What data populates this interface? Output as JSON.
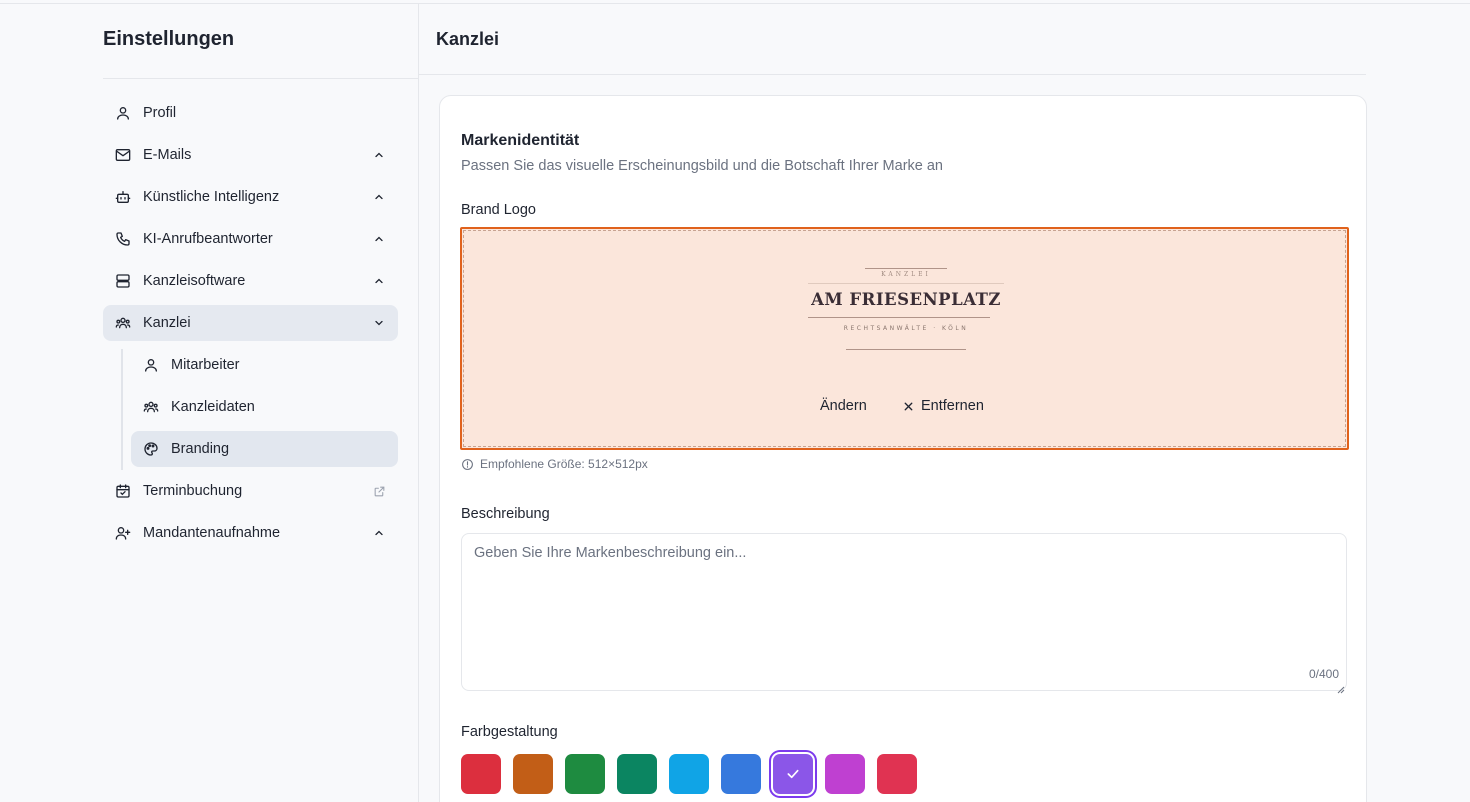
{
  "sidebar": {
    "title": "Einstellungen",
    "items": [
      {
        "label": "Profil",
        "icon": "user-icon"
      },
      {
        "label": "E-Mails",
        "icon": "mail-icon"
      },
      {
        "label": "Künstliche Intelligenz",
        "icon": "bot-icon"
      },
      {
        "label": "KI-Anrufbeantworter",
        "icon": "phone-icon"
      },
      {
        "label": "Kanzleisoftware",
        "icon": "server-icon"
      },
      {
        "label": "Kanzlei",
        "icon": "users-icon",
        "active": true
      },
      {
        "label": "Terminbuchung",
        "icon": "calendar-check-icon"
      },
      {
        "label": "Mandantenaufnahme",
        "icon": "user-plus-icon"
      }
    ],
    "sub_items": [
      {
        "label": "Mitarbeiter",
        "icon": "user-icon"
      },
      {
        "label": "Kanzleidaten",
        "icon": "users-icon"
      },
      {
        "label": "Branding",
        "icon": "palette-icon",
        "active": true
      }
    ]
  },
  "main": {
    "title": "Kanzlei",
    "card": {
      "title": "Markenidentität",
      "subtitle": "Passen Sie das visuelle Erscheinungsbild und die Botschaft Ihrer Marke an",
      "logo": {
        "label": "Brand Logo",
        "logo_top": "KANZLEI",
        "logo_name": "AM FRIESENPLATZ",
        "logo_sub": "RECHTSANWÄLTE · KÖLN",
        "change_label": "Ändern",
        "remove_label": "Entfernen",
        "hint": "Empfohlene Größe: 512×512px"
      },
      "description": {
        "label": "Beschreibung",
        "placeholder": "Geben Sie Ihre Markenbeschreibung ein...",
        "value": "",
        "counter": "0/400"
      },
      "colors": {
        "label": "Farbgestaltung",
        "selected_index": 6,
        "swatches": [
          "#dc2f3e",
          "#c25e17",
          "#1e8b40",
          "#0b8561",
          "#10a4e6",
          "#3679dd",
          "#8b56e8",
          "#bf40d1",
          "#e03352"
        ]
      }
    }
  }
}
